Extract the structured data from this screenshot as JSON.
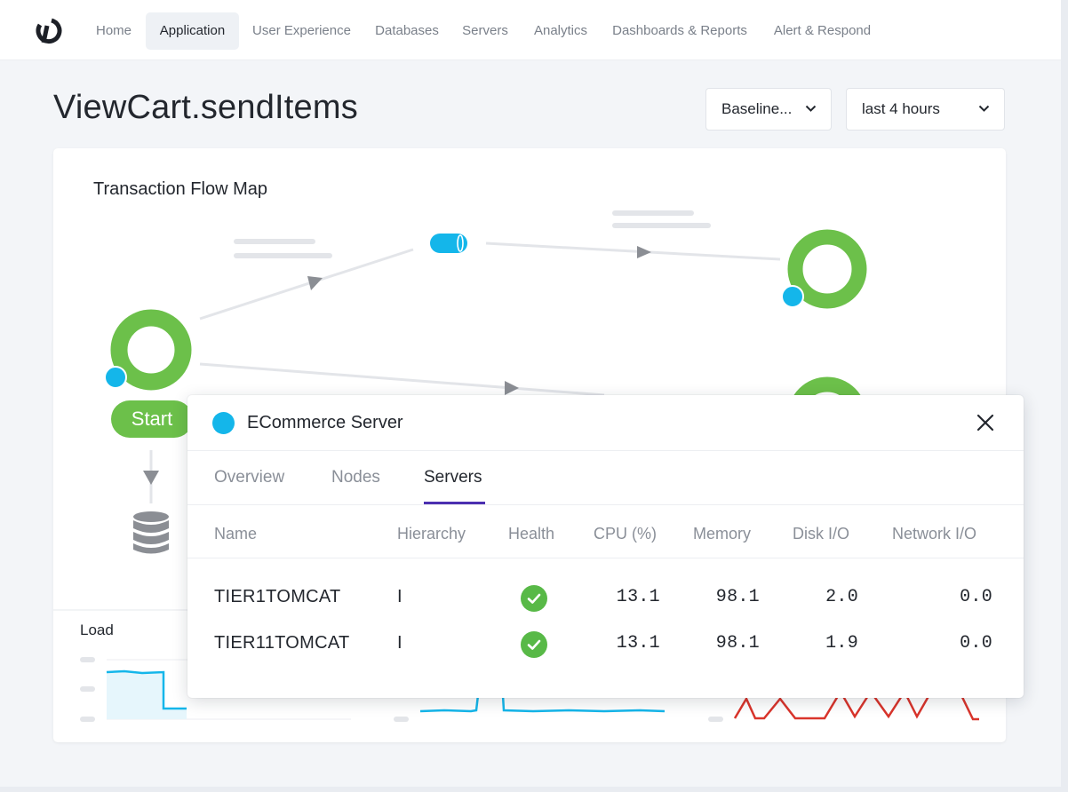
{
  "nav": {
    "items": [
      {
        "label": "Home",
        "active": false
      },
      {
        "label": "Application",
        "active": true
      },
      {
        "label": "User Experience",
        "active": false
      },
      {
        "label": "Databases",
        "active": false
      },
      {
        "label": "Servers",
        "active": false
      },
      {
        "label": "Analytics",
        "active": false
      },
      {
        "label": "Dashboards & Reports",
        "active": false
      },
      {
        "label": "Alert & Respond",
        "active": false
      }
    ]
  },
  "header": {
    "title": "ViewCart.sendItems",
    "baseline_select": "Baseline...",
    "time_select": "last 4 hours"
  },
  "flow_map": {
    "title": "Transaction Flow Map",
    "start_label": "Start"
  },
  "load": {
    "label": "Load"
  },
  "popup": {
    "title": "ECommerce Server",
    "tabs": [
      {
        "label": "Overview",
        "active": false
      },
      {
        "label": "Nodes",
        "active": false
      },
      {
        "label": "Servers",
        "active": true
      }
    ],
    "columns": [
      "Name",
      "Hierarchy",
      "Health",
      "CPU (%)",
      "Memory",
      "Disk I/O",
      "Network I/O"
    ],
    "rows": [
      {
        "name": "TIER1TOMCAT",
        "hierarchy": "I",
        "health": "ok",
        "cpu": "13.1",
        "memory": "98.1",
        "disk": "2.0",
        "network": "0.0"
      },
      {
        "name": "TIER11TOMCAT",
        "hierarchy": "I",
        "health": "ok",
        "cpu": "13.1",
        "memory": "98.1",
        "disk": "1.9",
        "network": "0.0"
      }
    ]
  },
  "colors": {
    "accent": "#4b2fb0",
    "healthy": "#6cc04a",
    "node_badge": "#14b6ea",
    "alert_line": "#d9342b"
  }
}
